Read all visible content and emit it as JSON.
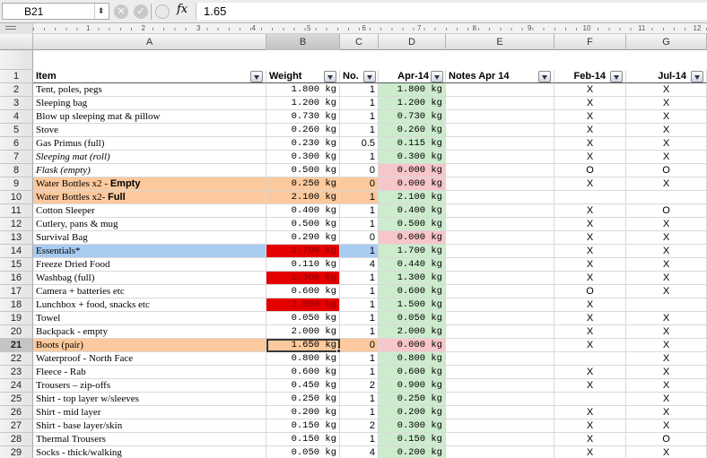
{
  "formula_bar": {
    "cell_ref": "B21",
    "value": "1.65",
    "fx_label": "fx",
    "cancel_glyph": "⊗",
    "accept_glyph": "✓"
  },
  "ruler": {
    "numbers": [
      "1",
      "2",
      "3",
      "4",
      "5",
      "6",
      "7",
      "8",
      "9",
      "10",
      "11",
      "12"
    ]
  },
  "columns": {
    "A": "A",
    "B": "B",
    "C": "C",
    "D": "D",
    "E": "E",
    "F": "F",
    "G": "G"
  },
  "selected_cell": "B21",
  "header_row": {
    "num": "1",
    "item": "Item",
    "weight": "Weight",
    "no": "No.",
    "apr14": "Apr-14",
    "notes": "Notes Apr 14",
    "feb14": "Feb-14",
    "jul14": "Jul-14"
  },
  "rows": [
    {
      "n": "2",
      "item": "Tent, poles, pegs",
      "weight": "1.800 kg",
      "no": "1",
      "apr": "1.800 kg",
      "feb": "X",
      "jul": "X",
      "style": "",
      "dstyle": "green"
    },
    {
      "n": "3",
      "item": "Sleeping bag",
      "weight": "1.200 kg",
      "no": "1",
      "apr": "1.200 kg",
      "feb": "X",
      "jul": "X",
      "style": "",
      "dstyle": "green"
    },
    {
      "n": "4",
      "item": "Blow up sleeping mat & pillow",
      "weight": "0.730 kg",
      "no": "1",
      "apr": "0.730 kg",
      "feb": "X",
      "jul": "X",
      "style": "",
      "dstyle": "green"
    },
    {
      "n": "5",
      "item": "Stove",
      "weight": "0.260 kg",
      "no": "1",
      "apr": "0.260 kg",
      "feb": "X",
      "jul": "X",
      "style": "",
      "dstyle": "green"
    },
    {
      "n": "6",
      "item": "Gas Primus (full)",
      "weight": "0.230 kg",
      "no": "0.5",
      "apr": "0.115 kg",
      "feb": "X",
      "jul": "X",
      "style": "",
      "dstyle": "green"
    },
    {
      "n": "7",
      "item": "Sleeping mat (roll)",
      "weight": "0.300 kg",
      "no": "1",
      "apr": "0.300 kg",
      "feb": "X",
      "jul": "X",
      "style": "italic",
      "dstyle": "green"
    },
    {
      "n": "8",
      "item": "Flask (empty)",
      "weight": "0.500 kg",
      "no": "0",
      "apr": "0.000 kg",
      "feb": "O",
      "jul": "O",
      "style": "italic",
      "dstyle": "pink"
    },
    {
      "n": "9",
      "item": "Water Bottles x2 - ",
      "item_bold": "Empty",
      "weight": "0.250 kg",
      "no": "0",
      "apr": "0.000 kg",
      "feb": "X",
      "jul": "X",
      "style": "peach",
      "dstyle": "pink"
    },
    {
      "n": "10",
      "item": "Water Bottles x2- ",
      "item_bold": "Full",
      "weight": "2.100 kg",
      "no": "1",
      "apr": "2.100 kg",
      "feb": "",
      "jul": "",
      "style": "peach",
      "dstyle": "green"
    },
    {
      "n": "11",
      "item": "Cotton  Sleeper",
      "weight": "0.400 kg",
      "no": "1",
      "apr": "0.400 kg",
      "feb": "X",
      "jul": "O",
      "style": "",
      "dstyle": "green"
    },
    {
      "n": "12",
      "item": "Cutlery, pans & mug",
      "weight": "0.500 kg",
      "no": "1",
      "apr": "0.500 kg",
      "feb": "X",
      "jul": "X",
      "style": "",
      "dstyle": "green"
    },
    {
      "n": "13",
      "item": "Survival Bag",
      "weight": "0.290 kg",
      "no": "0",
      "apr": "0.000 kg",
      "feb": "X",
      "jul": "X",
      "style": "",
      "dstyle": "pink"
    },
    {
      "n": "14",
      "item": "Essentials*",
      "weight": "1.700 kg",
      "no": "1",
      "apr": "1.700 kg",
      "feb": "X",
      "jul": "X",
      "style": "blue",
      "bstyle": "red",
      "dstyle": "green"
    },
    {
      "n": "15",
      "item": "Freeze Dried Food",
      "weight": "0.110 kg",
      "no": "4",
      "apr": "0.440 kg",
      "feb": "X",
      "jul": "X",
      "style": "",
      "dstyle": "green"
    },
    {
      "n": "16",
      "item": "Washbag (full)",
      "weight": "1.300 kg",
      "no": "1",
      "apr": "1.300 kg",
      "feb": "X",
      "jul": "X",
      "style": "",
      "bstyle": "red",
      "dstyle": "green"
    },
    {
      "n": "17",
      "item": "Camera + batteries etc",
      "weight": "0.600 kg",
      "no": "1",
      "apr": "0.600 kg",
      "feb": "O",
      "jul": "X",
      "style": "",
      "dstyle": "green"
    },
    {
      "n": "18",
      "item": "Lunchbox + food, snacks etc",
      "weight": "2.000 kg",
      "no": "1",
      "apr": "1.500 kg",
      "feb": "X",
      "jul": "",
      "style": "",
      "bstyle": "red",
      "dstyle": "green"
    },
    {
      "n": "19",
      "item": "Towel",
      "weight": "0.050 kg",
      "no": "1",
      "apr": "0.050 kg",
      "feb": "X",
      "jul": "X",
      "style": "",
      "dstyle": "green"
    },
    {
      "n": "20",
      "item": "Backpack - empty",
      "weight": "2.000 kg",
      "no": "1",
      "apr": "2.000 kg",
      "feb": "X",
      "jul": "X",
      "style": "",
      "dstyle": "green"
    },
    {
      "n": "21",
      "item": "Boots (pair)",
      "weight": "1.650 kg",
      "no": "0",
      "apr": "0.000 kg",
      "feb": "X",
      "jul": "X",
      "style": "peach",
      "dstyle": "pink",
      "selected": true
    },
    {
      "n": "22",
      "item": "Waterproof - North Face",
      "weight": "0.800 kg",
      "no": "1",
      "apr": "0.800 kg",
      "feb": "",
      "jul": "X",
      "style": "",
      "dstyle": "green"
    },
    {
      "n": "23",
      "item": "Fleece - Rab",
      "weight": "0.600 kg",
      "no": "1",
      "apr": "0.600 kg",
      "feb": "X",
      "jul": "X",
      "style": "",
      "dstyle": "green"
    },
    {
      "n": "24",
      "item": "Trousers – zip-offs",
      "weight": "0.450 kg",
      "no": "2",
      "apr": "0.900 kg",
      "feb": "X",
      "jul": "X",
      "style": "",
      "dstyle": "green"
    },
    {
      "n": "25",
      "item": "Shirt - top layer w/sleeves",
      "weight": "0.250 kg",
      "no": "1",
      "apr": "0.250 kg",
      "feb": "",
      "jul": "X",
      "style": "",
      "dstyle": "green"
    },
    {
      "n": "26",
      "item": "Shirt - mid layer",
      "weight": "0.200 kg",
      "no": "1",
      "apr": "0.200 kg",
      "feb": "X",
      "jul": "X",
      "style": "",
      "dstyle": "green"
    },
    {
      "n": "27",
      "item": "Shirt - base layer/skin",
      "weight": "0.150 kg",
      "no": "2",
      "apr": "0.300 kg",
      "feb": "X",
      "jul": "X",
      "style": "",
      "dstyle": "green"
    },
    {
      "n": "28",
      "item": "Thermal Trousers",
      "weight": "0.150 kg",
      "no": "1",
      "apr": "0.150 kg",
      "feb": "X",
      "jul": "O",
      "style": "",
      "dstyle": "green"
    },
    {
      "n": "29",
      "item": "Socks - thick/walking",
      "weight": "0.050 kg",
      "no": "4",
      "apr": "0.200 kg",
      "feb": "X",
      "jul": "X",
      "style": "",
      "dstyle": "green"
    }
  ]
}
